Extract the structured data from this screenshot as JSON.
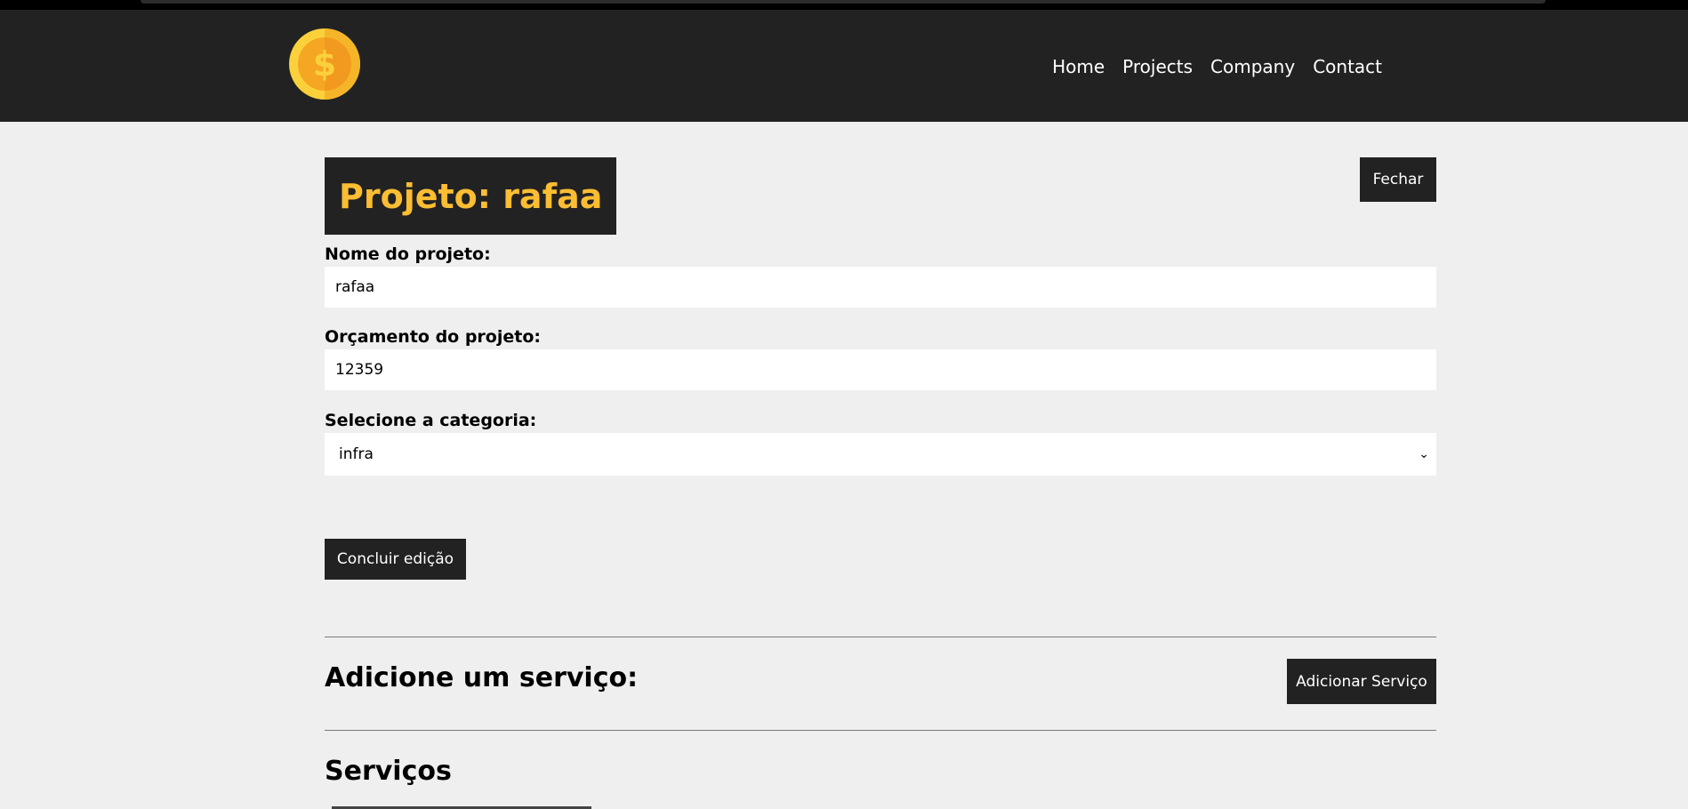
{
  "nav": {
    "logo_icon": "dollar-coin-icon",
    "links": [
      "Home",
      "Projects",
      "Company",
      "Contact"
    ]
  },
  "project": {
    "title": "Projeto: rafaa",
    "close_label": "Fechar"
  },
  "form": {
    "name_label": "Nome do projeto:",
    "name_value": "rafaa",
    "budget_label": "Orçamento do projeto:",
    "budget_value": "12359",
    "category_label": "Selecione a categoria:",
    "category_value": "infra",
    "submit_label": "Concluir edição"
  },
  "services": {
    "add_title": "Adicione um serviço:",
    "add_button": "Adicionar Serviço",
    "list_title": "Serviços"
  },
  "colors": {
    "accent": "#fbbd32",
    "dark": "#222222",
    "background": "#efefef"
  }
}
